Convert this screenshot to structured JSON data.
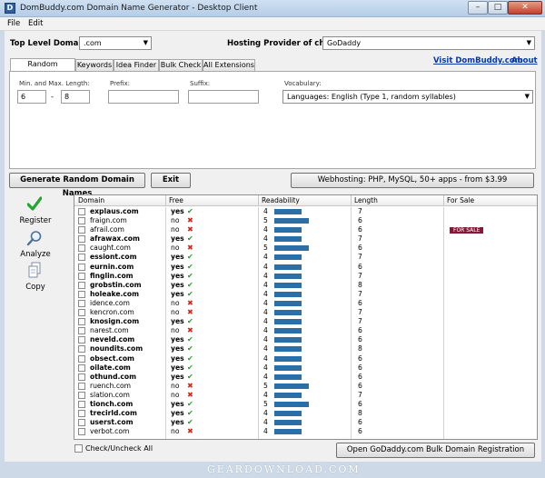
{
  "window": {
    "title": "DomBuddy.com Domain Name Generator - Desktop Client",
    "icon": "D",
    "min": "–",
    "max": "□",
    "close": "✕"
  },
  "menu": {
    "file": "File",
    "edit": "Edit"
  },
  "top": {
    "tld_label": "Top Level Domain:",
    "tld_value": ".com",
    "host_label": "Hosting Provider of choice:",
    "host_value": "GoDaddy"
  },
  "tabs": [
    "Random Syllables",
    "Keywords",
    "Idea Finder",
    "Bulk Check",
    "All Extensions"
  ],
  "links": {
    "visit": "Visit DomBuddy.com",
    "about": "About"
  },
  "panel": {
    "minmax_label": "Min. and Max. Length:",
    "min_value": "6",
    "dash": "-",
    "max_value": "8",
    "prefix_label": "Prefix:",
    "suffix_label": "Suffix:",
    "vocab_label": "Vocabulary:",
    "vocab_value": "Languages: English (Type 1, random syllables)"
  },
  "buttons": {
    "generate": "Generate Random Domain Names",
    "exit": "Exit",
    "hosting": "Webhosting: PHP, MySQL, 50+ apps - from $3.99",
    "open_bulk": "Open GoDaddy.com Bulk Domain Registration"
  },
  "side": {
    "register": "Register",
    "analyze": "Analyze",
    "copy": "Copy"
  },
  "grid": {
    "headers": {
      "domain": "Domain",
      "free": "Free",
      "readability": "Readability",
      "length": "Length",
      "for_sale": "For Sale"
    },
    "for_sale_badge": "FOR SALE",
    "max_readability": 5,
    "rows": [
      {
        "domain": "explaus.com",
        "free": "yes",
        "readability": 4,
        "length": 7
      },
      {
        "domain": "fraign.com",
        "free": "no",
        "readability": 5,
        "length": 6
      },
      {
        "domain": "afrail.com",
        "free": "no",
        "readability": 4,
        "length": 6,
        "for_sale": true
      },
      {
        "domain": "afrawax.com",
        "free": "yes",
        "readability": 4,
        "length": 7
      },
      {
        "domain": "caught.com",
        "free": "no",
        "readability": 5,
        "length": 6
      },
      {
        "domain": "essiont.com",
        "free": "yes",
        "readability": 4,
        "length": 7
      },
      {
        "domain": "eurnin.com",
        "free": "yes",
        "readability": 4,
        "length": 6
      },
      {
        "domain": "finglin.com",
        "free": "yes",
        "readability": 4,
        "length": 7
      },
      {
        "domain": "grobstin.com",
        "free": "yes",
        "readability": 4,
        "length": 8
      },
      {
        "domain": "holeake.com",
        "free": "yes",
        "readability": 4,
        "length": 7
      },
      {
        "domain": "idence.com",
        "free": "no",
        "readability": 4,
        "length": 6
      },
      {
        "domain": "kencron.com",
        "free": "no",
        "readability": 4,
        "length": 7
      },
      {
        "domain": "knosign.com",
        "free": "yes",
        "readability": 4,
        "length": 7
      },
      {
        "domain": "narest.com",
        "free": "no",
        "readability": 4,
        "length": 6
      },
      {
        "domain": "neveld.com",
        "free": "yes",
        "readability": 4,
        "length": 6
      },
      {
        "domain": "noundits.com",
        "free": "yes",
        "readability": 4,
        "length": 8
      },
      {
        "domain": "obsect.com",
        "free": "yes",
        "readability": 4,
        "length": 6
      },
      {
        "domain": "oilate.com",
        "free": "yes",
        "readability": 4,
        "length": 6
      },
      {
        "domain": "othund.com",
        "free": "yes",
        "readability": 4,
        "length": 6
      },
      {
        "domain": "ruench.com",
        "free": "no",
        "readability": 5,
        "length": 6
      },
      {
        "domain": "slation.com",
        "free": "no",
        "readability": 4,
        "length": 7
      },
      {
        "domain": "tionch.com",
        "free": "yes",
        "readability": 5,
        "length": 6
      },
      {
        "domain": "trecirld.com",
        "free": "yes",
        "readability": 4,
        "length": 8
      },
      {
        "domain": "userst.com",
        "free": "yes",
        "readability": 4,
        "length": 6
      },
      {
        "domain": "verbot.com",
        "free": "no",
        "readability": 4,
        "length": 6
      }
    ]
  },
  "check_all": "Check/Uncheck All",
  "watermark": "GEARDOWNLOAD.COM",
  "colors": {
    "bar": "#2b6fa8",
    "yes": "#1f9d2a",
    "no": "#d0261c",
    "for_sale": "#8a1538"
  }
}
